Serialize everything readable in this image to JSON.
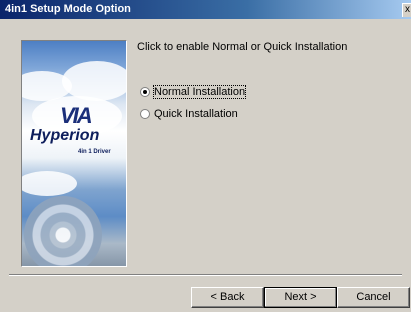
{
  "window": {
    "title": "4in1 Setup Mode Option",
    "close_glyph": "x"
  },
  "banner": {
    "logo_text": "VIA",
    "product": "Hyperion",
    "subtitle": "4in 1 Driver"
  },
  "main": {
    "prompt": "Click to enable Normal or Quick Installation",
    "options": [
      {
        "label": "Normal Installation",
        "selected": true
      },
      {
        "label": "Quick Installation",
        "selected": false
      }
    ]
  },
  "buttons": {
    "back": "< Back",
    "next": "Next >",
    "cancel": "Cancel"
  },
  "colors": {
    "titlebar_start": "#0a246a",
    "titlebar_end": "#a6caf0",
    "face": "#d4d0c8"
  }
}
